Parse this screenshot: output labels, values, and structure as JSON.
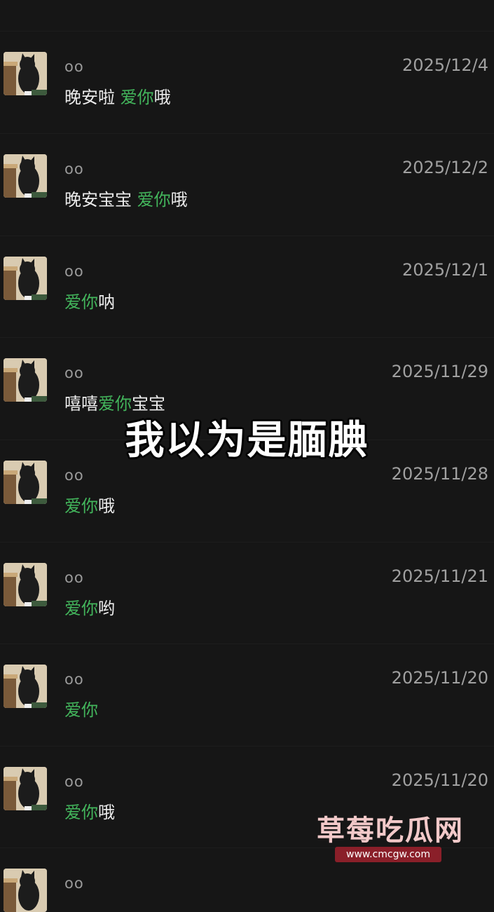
{
  "colors": {
    "background": "#161616",
    "love_text": "#43b65c",
    "watermark_badge": "#8a1f29"
  },
  "messages": [
    {
      "name": "oo",
      "date": "2025/12/4",
      "pre": "晚安啦 ",
      "love": "爱你",
      "post": "哦"
    },
    {
      "name": "oo",
      "date": "2025/12/2",
      "pre": "晚安宝宝 ",
      "love": "爱你",
      "post": "哦"
    },
    {
      "name": "oo",
      "date": "2025/12/1",
      "pre": "",
      "love": "爱你",
      "post": "呐"
    },
    {
      "name": "oo",
      "date": "2025/11/29",
      "pre": "嘻嘻",
      "love": "爱你",
      "post": "宝宝"
    },
    {
      "name": "oo",
      "date": "2025/11/28",
      "pre": "",
      "love": "爱你",
      "post": "哦"
    },
    {
      "name": "oo",
      "date": "2025/11/21",
      "pre": "",
      "love": "爱你",
      "post": "哟"
    },
    {
      "name": "oo",
      "date": "2025/11/20",
      "pre": "",
      "love": "爱你",
      "post": ""
    },
    {
      "name": "oo",
      "date": "2025/11/20",
      "pre": "",
      "love": "爱你",
      "post": "哦"
    },
    {
      "name": "oo",
      "date": "",
      "pre": "",
      "love": "",
      "post": ""
    }
  ],
  "overlay": {
    "caption": "我以为是腼腆"
  },
  "watermark": {
    "title": "草莓吃瓜网",
    "url": "www.cmcgw.com"
  }
}
